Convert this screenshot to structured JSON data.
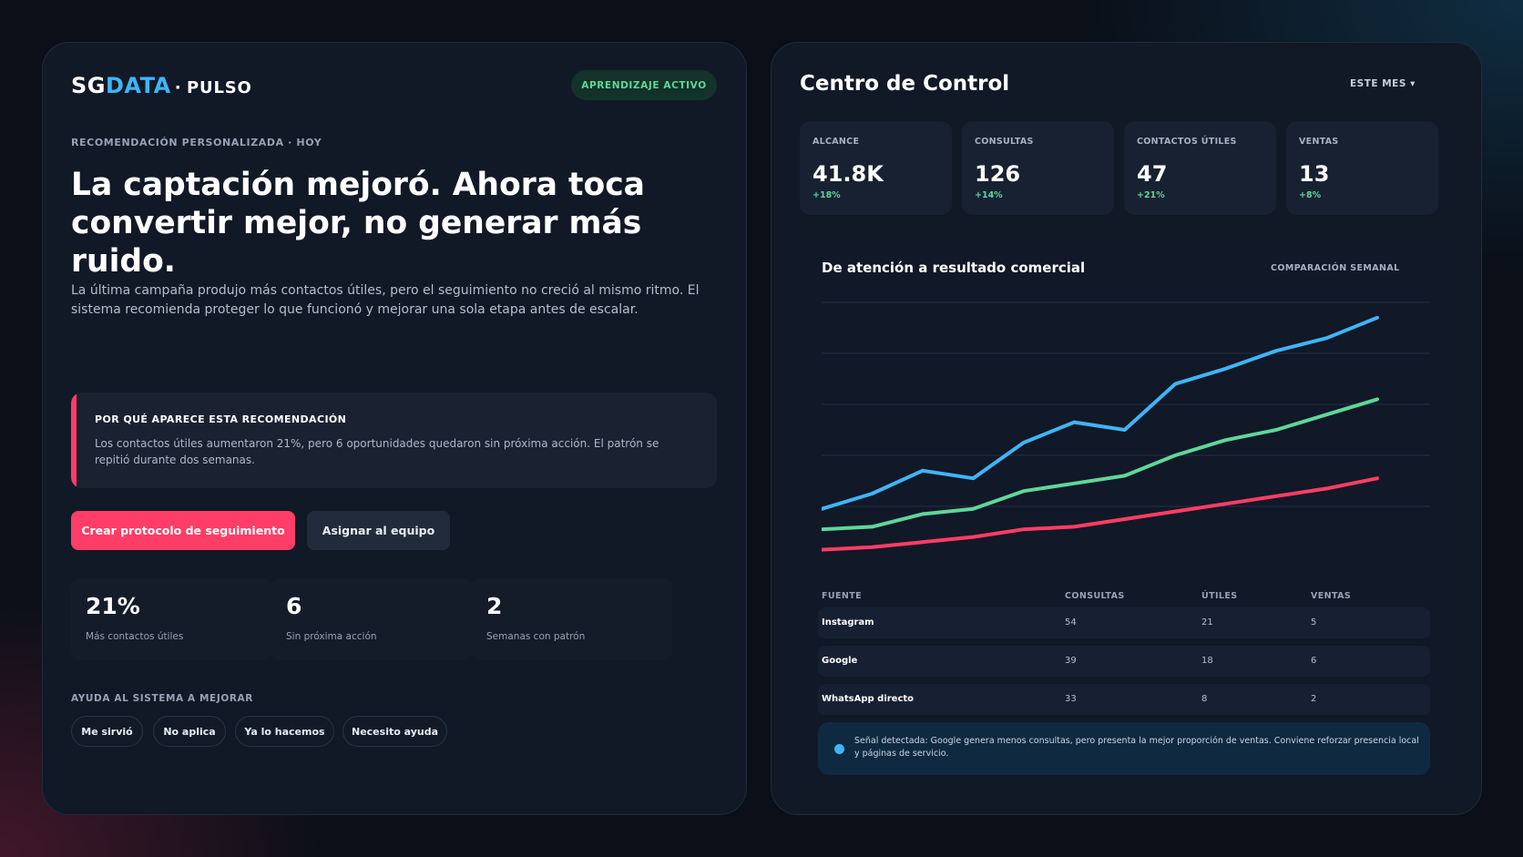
{
  "brand": {
    "sg": "SG",
    "data": "DATA",
    "separator": "·",
    "product": "PULSO"
  },
  "status_pill": "APRENDIZAJE ACTIVO",
  "recommendation": {
    "eyebrow": "RECOMENDACIÓN PERSONALIZADA · HOY",
    "headline": "La captación mejoró. Ahora toca convertir mejor, no generar más ruido.",
    "description": "La última campaña produjo más contactos útiles, pero el seguimiento no creció al mismo ritmo. El sistema recomienda proteger lo que funcionó y mejorar una sola etapa antes de escalar.",
    "reason_title": "POR QUÉ APARECE ESTA RECOMENDACIÓN",
    "reason_text": "Los contactos útiles aumentaron 21%, pero 6 oportunidades quedaron sin próxima acción. El patrón se repitió durante dos semanas.",
    "primary_button": "Crear protocolo de seguimiento",
    "secondary_button": "Asignar al equipo",
    "metrics": [
      {
        "value": "21%",
        "label": "Más contactos útiles"
      },
      {
        "value": "6",
        "label": "Sin próxima acción"
      },
      {
        "value": "2",
        "label": "Semanas con patrón"
      }
    ],
    "feedback_title": "AYUDA AL SISTEMA A MEJORAR",
    "feedback_options": [
      "Me sirvió",
      "No aplica",
      "Ya lo hacemos",
      "Necesito ayuda"
    ]
  },
  "control": {
    "title": "Centro de Control",
    "period": "ESTE MES ▾",
    "kpis": [
      {
        "label": "ALCANCE",
        "value": "41.8K",
        "change": "+18%"
      },
      {
        "label": "CONSULTAS",
        "value": "126",
        "change": "+14%"
      },
      {
        "label": "CONTACTOS ÚTILES",
        "value": "47",
        "change": "+21%"
      },
      {
        "label": "VENTAS",
        "value": "13",
        "change": "+8%"
      }
    ],
    "chart_title": "De atención a resultado comercial",
    "chart_subtitle": "COMPARACIÓN SEMANAL",
    "table": {
      "headers": [
        "FUENTE",
        "CONSULTAS",
        "ÚTILES",
        "VENTAS"
      ],
      "rows": [
        [
          "Instagram",
          "54",
          "21",
          "5"
        ],
        [
          "Google",
          "39",
          "18",
          "6"
        ],
        [
          "WhatsApp directo",
          "33",
          "8",
          "2"
        ]
      ]
    },
    "signal": "Señal detectada: Google genera menos consultas, pero presenta la mejor proporción de ventas. Conviene reforzar presencia local y páginas de servicio."
  },
  "colors": {
    "accent": "#ff3d66",
    "blue": "#40b4f6",
    "green": "#5fd69a",
    "background": "#0a0f18",
    "panel": "#111927"
  },
  "chart_data": {
    "type": "line",
    "title": "De atención a resultado comercial",
    "subtitle": "COMPARACIÓN SEMANAL",
    "xlabel": "",
    "ylabel": "",
    "x": [
      1,
      2,
      3,
      4,
      5,
      6,
      7,
      8,
      9,
      10,
      11,
      12
    ],
    "ylim": [
      0,
      100
    ],
    "grid": true,
    "series": [
      {
        "color": "#40b4f6",
        "values": [
          19,
          25,
          34,
          31,
          45,
          53,
          50,
          68,
          74,
          81,
          86,
          94
        ]
      },
      {
        "color": "#5fd69a",
        "values": [
          11,
          12,
          17,
          19,
          26,
          29,
          32,
          40,
          46,
          50,
          56,
          62
        ]
      },
      {
        "color": "#ff3d66",
        "values": [
          3,
          4,
          6,
          8,
          11,
          12,
          15,
          18,
          21,
          24,
          27,
          31
        ]
      }
    ]
  }
}
